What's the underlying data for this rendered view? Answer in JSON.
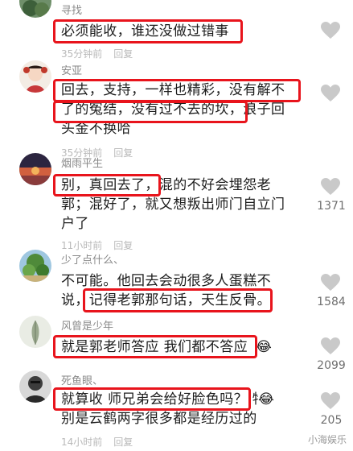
{
  "comments": [
    {
      "username": "寻找",
      "lines": [
        "必须能收，谁还没做过错事"
      ],
      "time": "35分钟前",
      "reply": "回复",
      "likes": ""
    },
    {
      "username": "安亚",
      "lines": [
        "回去，支持，一样也精彩，没有解不",
        "了的冤结，没有过不去的坎，浪子回",
        "头金不换哈"
      ],
      "time": "35分钟前",
      "reply": "回复",
      "likes": ""
    },
    {
      "username": "烟雨平生",
      "lines": [
        "别，真回去了，混的不好会埋怨老",
        "郭；混好了，就又想叛出师门自立门",
        "户了"
      ],
      "time": "11小时前",
      "reply": "回复",
      "likes": "1371"
    },
    {
      "username": "少了点什么、",
      "lines": [
        "不可能。他回去会动很多人蛋糕不",
        "说，记得老郭那句话，天生反骨。"
      ],
      "time": "",
      "reply": "",
      "likes": "1584"
    },
    {
      "username": "风曾是少年",
      "lines": [
        "就是郭老师答应 我们都不答应"
      ],
      "time": "",
      "reply": "",
      "likes": "2099"
    },
    {
      "username": "死鱼眼、",
      "lines": [
        "就算收 师兄弟会给好脸色吗？ 特",
        "别是云鹤两字很多都是经历过的"
      ],
      "time": "14小时前",
      "reply": "回复",
      "likes": "205"
    }
  ],
  "watermark": "小海娱乐",
  "colors": {
    "highlight": "#e8141c",
    "text": "#1c1c1c",
    "meta": "#b9b9b9",
    "heart": "#c9c9c9"
  }
}
